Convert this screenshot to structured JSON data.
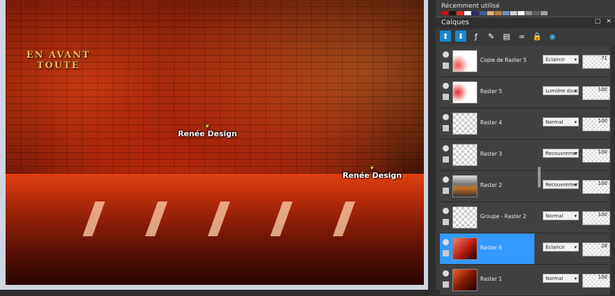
{
  "canvas": {
    "text_en_avant": "EN AVANT\nTOUTE",
    "watermark_1": "Renée Design",
    "watermark_2": "Renée Design"
  },
  "panel": {
    "recent_title": "Récemment utilisé",
    "swatches": [
      "#c81010",
      "#1a1a1a",
      "#e03020",
      "#ffffff",
      "#2a2a6a",
      "#4060a0",
      "#e0b070",
      "#c08040",
      "#7090c0",
      "#d0d0d0",
      "#ffffff",
      "#909090",
      "#606060",
      "#a0a0a0"
    ],
    "calques_title": "Calques",
    "toolbar_icons": [
      "new-raster-icon",
      "new-vector-icon",
      "group-icon",
      "mask-icon",
      "adjust-icon",
      "link-icon",
      "lock-icon",
      "effects-icon"
    ],
    "layers": [
      {
        "name": "Copie de Raster 5",
        "blend": "Éclaircir",
        "opacity": "71",
        "selected": false
      },
      {
        "name": "Raster 5",
        "blend": "Lumière douce",
        "opacity": "100",
        "selected": false
      },
      {
        "name": "Raster 4",
        "blend": "Normal",
        "opacity": "100",
        "selected": false
      },
      {
        "name": "Raster 3",
        "blend": "Recouvrement",
        "opacity": "100",
        "selected": false
      },
      {
        "name": "Raster 2",
        "blend": "Recouvrement",
        "opacity": "100",
        "selected": false
      },
      {
        "name": "Groupe - Raster 2",
        "blend": "Normal",
        "opacity": "100",
        "selected": false
      },
      {
        "name": "Raster 6",
        "blend": "Éclaircir",
        "opacity": "28",
        "selected": true
      },
      {
        "name": "Raster 1",
        "blend": "Normal",
        "opacity": "100",
        "selected": false
      }
    ]
  }
}
